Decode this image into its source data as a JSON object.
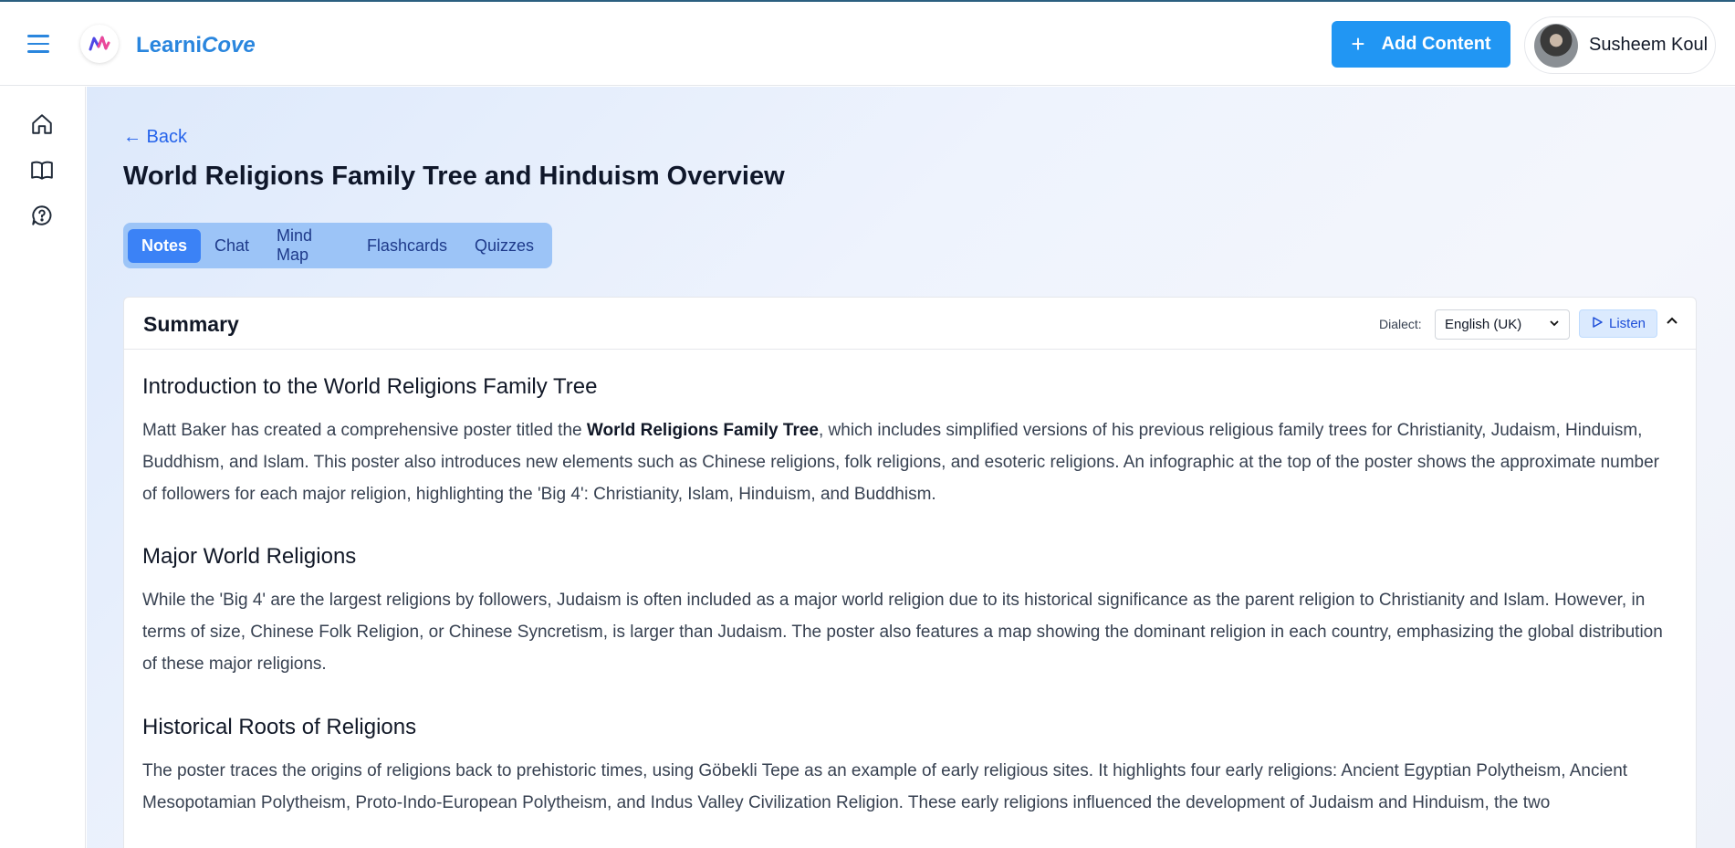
{
  "header": {
    "brand_prefix": "Learni",
    "brand_suffix": "Cove",
    "add_content_label": "Add Content",
    "user_name": "Susheem Koul"
  },
  "sidebar": {
    "items": [
      {
        "icon": "home-icon"
      },
      {
        "icon": "book-icon"
      },
      {
        "icon": "chat-question-icon"
      }
    ]
  },
  "main": {
    "back_label": "← Back",
    "title": "World Religions Family Tree and Hinduism Overview",
    "tabs": [
      {
        "label": "Notes",
        "active": true
      },
      {
        "label": "Chat"
      },
      {
        "label": "Mind Map"
      },
      {
        "label": "Flashcards"
      },
      {
        "label": "Quizzes"
      }
    ]
  },
  "summary": {
    "title": "Summary",
    "dialect_label": "Dialect:",
    "dialect_value": "English (UK)",
    "listen_label": "Listen",
    "sections": [
      {
        "heading": "Introduction to the World Religions Family Tree",
        "text_before": "Matt Baker has created a comprehensive poster titled the ",
        "bold": "World Religions Family Tree",
        "text_after": ", which includes simplified versions of his previous religious family trees for Christianity, Judaism, Hinduism, Buddhism, and Islam. This poster also introduces new elements such as Chinese religions, folk religions, and esoteric religions. An infographic at the top of the poster shows the approximate number of followers for each major religion, highlighting the 'Big 4': Christianity, Islam, Hinduism, and Buddhism."
      },
      {
        "heading": "Major World Religions",
        "text": "While the 'Big 4' are the largest religions by followers, Judaism is often included as a major world religion due to its historical significance as the parent religion to Christianity and Islam. However, in terms of size, Chinese Folk Religion, or Chinese Syncretism, is larger than Judaism. The poster also features a map showing the dominant religion in each country, emphasizing the global distribution of these major religions."
      },
      {
        "heading": "Historical Roots of Religions",
        "text": "The poster traces the origins of religions back to prehistoric times, using Göbekli Tepe as an example of early religious sites. It highlights four early religions: Ancient Egyptian Polytheism, Ancient Mesopotamian Polytheism, Proto-Indo-European Polytheism, and Indus Valley Civilization Religion. These early religions influenced the development of Judaism and Hinduism, the two"
      }
    ]
  },
  "colors": {
    "accent": "#2196f3",
    "brand": "#2a86de",
    "tab_bg": "#9cc4f7",
    "tab_active": "#3b82f6"
  }
}
